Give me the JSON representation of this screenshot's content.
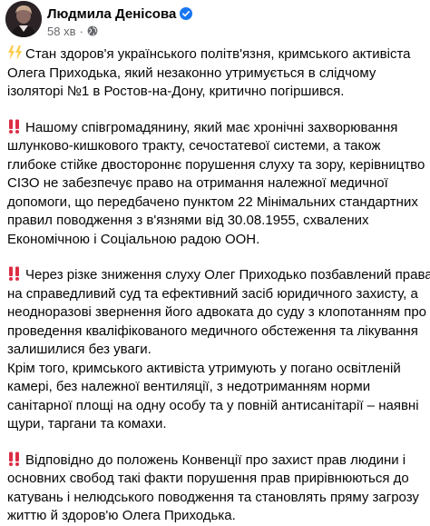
{
  "post": {
    "author": "Людмила Денісова",
    "time": "58 хв",
    "verified_icon": "verified-badge-icon",
    "audience_icon": "globe-icon",
    "accent_color": "#1877f2",
    "alert_color": "#dd2e44",
    "lightning_color": "#ffcc4d"
  },
  "paragraphs": [
    {
      "emoji": "lightning",
      "lines": [
        "Стан здоров'я українського політв'язня, кримського активіста",
        "Олега Приходька, який незаконно утримується в слідчому",
        "ізоляторі №1 в Ростов-на-Дону, критично погіршився."
      ]
    },
    {
      "emoji": "double-exclamation",
      "lines": [
        "Нашому співгромадянину, який має хронічні захворювання",
        "шлунково-кишкового тракту, сечостатевої системи, а також",
        "глибоке стійке двостороннє порушення слуху та зору, керівництво",
        "СІЗО не забезпечує право на отримання належної медичної",
        "допомоги, що передбачено пунктом 22 Мінімальних стандартних",
        "правил поводження з в'язнями від 30.08.1955, схвалених",
        "Економічною і Соціальною радою ООН."
      ]
    },
    {
      "emoji": "double-exclamation",
      "lines": [
        "Через різке зниження слуху Олег Приходько позбавлений права",
        "на справедливий суд та ефективний засіб юридичного захисту, а",
        "неодноразові звернення його адвоката до суду з клопотанням про",
        "проведення кваліфікованого медичного обстеження та лікування",
        "залишилися без уваги.",
        "Крім того, кримського активіста утримують у погано освітленій",
        "камері, без належної вентиляції, з недотриманням норми",
        "санітарної площі на одну особу та у повній антисанітарії – наявні",
        "щури, таргани та комахи."
      ]
    },
    {
      "emoji": "double-exclamation",
      "lines": [
        "Відповідно до положень Конвенції про захист прав людини і",
        "основних свобод такі факти порушення прав прирівнюються до",
        "катувань і нелюдського поводження та становлять пряму загрозу",
        "життю й здоров'ю Олега Приходька."
      ]
    }
  ]
}
